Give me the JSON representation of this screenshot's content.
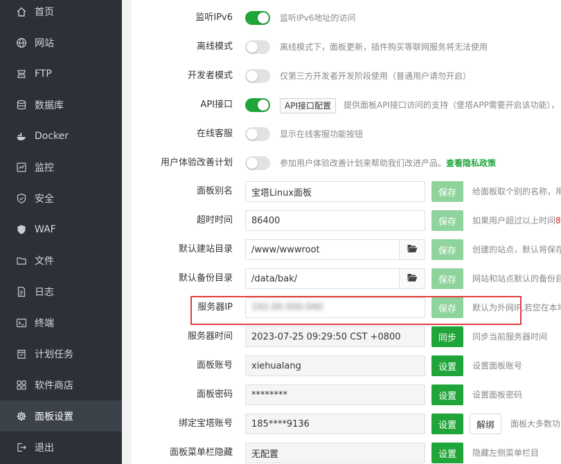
{
  "sidebar": {
    "items": [
      {
        "label": "首页",
        "icon": "home-icon",
        "active": false
      },
      {
        "label": "网站",
        "icon": "globe-icon",
        "active": false
      },
      {
        "label": "FTP",
        "icon": "ftp-icon",
        "active": false
      },
      {
        "label": "数据库",
        "icon": "database-icon",
        "active": false
      },
      {
        "label": "Docker",
        "icon": "docker-icon",
        "active": false
      },
      {
        "label": "监控",
        "icon": "monitor-icon",
        "active": false
      },
      {
        "label": "安全",
        "icon": "shield-icon",
        "active": false
      },
      {
        "label": "WAF",
        "icon": "waf-shield-icon",
        "active": false
      },
      {
        "label": "文件",
        "icon": "folder-icon",
        "active": false
      },
      {
        "label": "日志",
        "icon": "log-icon",
        "active": false
      },
      {
        "label": "终端",
        "icon": "terminal-icon",
        "active": false
      },
      {
        "label": "计划任务",
        "icon": "clock-icon",
        "active": false
      },
      {
        "label": "软件商店",
        "icon": "apps-grid-icon",
        "active": false
      },
      {
        "label": "面板设置",
        "icon": "gear-icon",
        "active": true
      },
      {
        "label": "退出",
        "icon": "logout-icon",
        "active": false
      }
    ]
  },
  "settings": {
    "ipv6": {
      "label": "监听IPv6",
      "on": true,
      "desc": "监听IPv6地址的访问"
    },
    "offline": {
      "label": "离线模式",
      "on": false,
      "desc": "离线模式下，面板更新，插件购买等联网服务将无法使用"
    },
    "developer": {
      "label": "开发者模式",
      "on": false,
      "desc": "仅第三方开发者开发阶段使用（普通用户请勿开启）"
    },
    "api": {
      "label": "API接口",
      "on": true,
      "button": "API接口配置",
      "desc": "提供面板API接口访问的支持（堡塔APP需要开启该功能），"
    },
    "support": {
      "label": "在线客服",
      "on": false,
      "desc": "显示在线客服功能按钮"
    },
    "ux_plan": {
      "label": "用户体验改善计划",
      "on": false,
      "desc": "参加用户体验改善计划来帮助我们改进产品。",
      "link": "查看隐私政策"
    },
    "alias": {
      "label": "面板别名",
      "value": "宝塔Linux面板",
      "button": "保存",
      "desc": "给面板取个别的名称，用"
    },
    "timeout": {
      "label": "超时时间",
      "value": "86400",
      "button": "保存",
      "desc": "如果用户超过以上时间",
      "desc_red": "8"
    },
    "site_dir": {
      "label": "默认建站目录",
      "value": "/www/wwwroot",
      "button": "保存",
      "desc": "创建的站点，默认将保存"
    },
    "backup_dir": {
      "label": "默认备份目录",
      "value": "/data/bak/",
      "button": "保存",
      "desc": "网站和站点默认的备份目"
    },
    "server_ip": {
      "label": "服务器IP",
      "value": "192.00.000.040",
      "button": "保存",
      "desc": "默认为外网IP,若您在本地"
    },
    "server_time": {
      "label": "服务器时间",
      "value": "2023-07-25 09:29:50 CST +0800",
      "button": "同步",
      "desc": "同步当前服务器时间"
    },
    "account": {
      "label": "面板账号",
      "value": "xiehualang",
      "button": "设置",
      "desc": "设置面板账号"
    },
    "password": {
      "label": "面板密码",
      "value": "********",
      "button": "设置",
      "desc": "设置面板密码"
    },
    "bt_account": {
      "label": "绑定宝塔账号",
      "value": "185****9136",
      "button": "设置",
      "button2": "解绑",
      "desc": "面板大多数功"
    },
    "menu_hide": {
      "label": "面板菜单栏隐藏",
      "value": "无配置",
      "button": "设置",
      "desc": "隐藏左侧菜单栏目"
    }
  },
  "colors": {
    "accent": "#20a53a",
    "accent_pale": "#8fd49c",
    "sidebar_bg": "#2c3138",
    "highlight": "#e23b3b"
  }
}
